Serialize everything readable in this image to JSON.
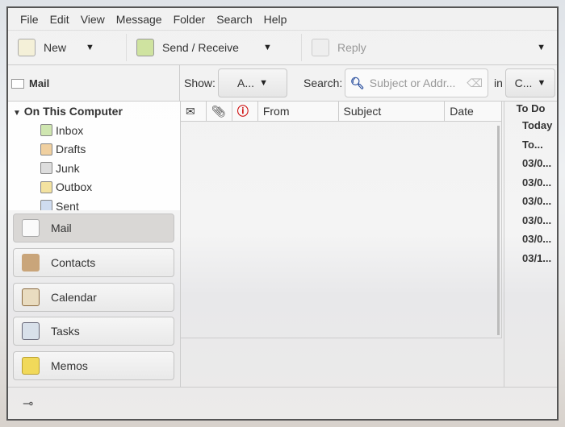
{
  "menu": [
    "File",
    "Edit",
    "View",
    "Message",
    "Folder",
    "Search",
    "Help"
  ],
  "toolbar": {
    "new": "New",
    "send_receive": "Send / Receive",
    "reply": "Reply"
  },
  "header": {
    "title": "Mail",
    "show_label": "Show:",
    "show_value": "A...",
    "search_label": "Search:",
    "search_placeholder": "Subject or Addr...",
    "in_label": "in",
    "in_value": "C..."
  },
  "tree": {
    "root": "On This Computer",
    "folders": [
      "Inbox",
      "Drafts",
      "Junk",
      "Outbox",
      "Sent"
    ]
  },
  "switcher": [
    "Mail",
    "Contacts",
    "Calendar",
    "Tasks",
    "Memos"
  ],
  "columns": {
    "from": "From",
    "subject": "Subject",
    "date": "Date"
  },
  "todo": {
    "title": "To Do",
    "items": [
      "Today",
      "To...",
      "03/0...",
      "03/0...",
      "03/0...",
      "03/0...",
      "03/0...",
      "03/1..."
    ]
  }
}
